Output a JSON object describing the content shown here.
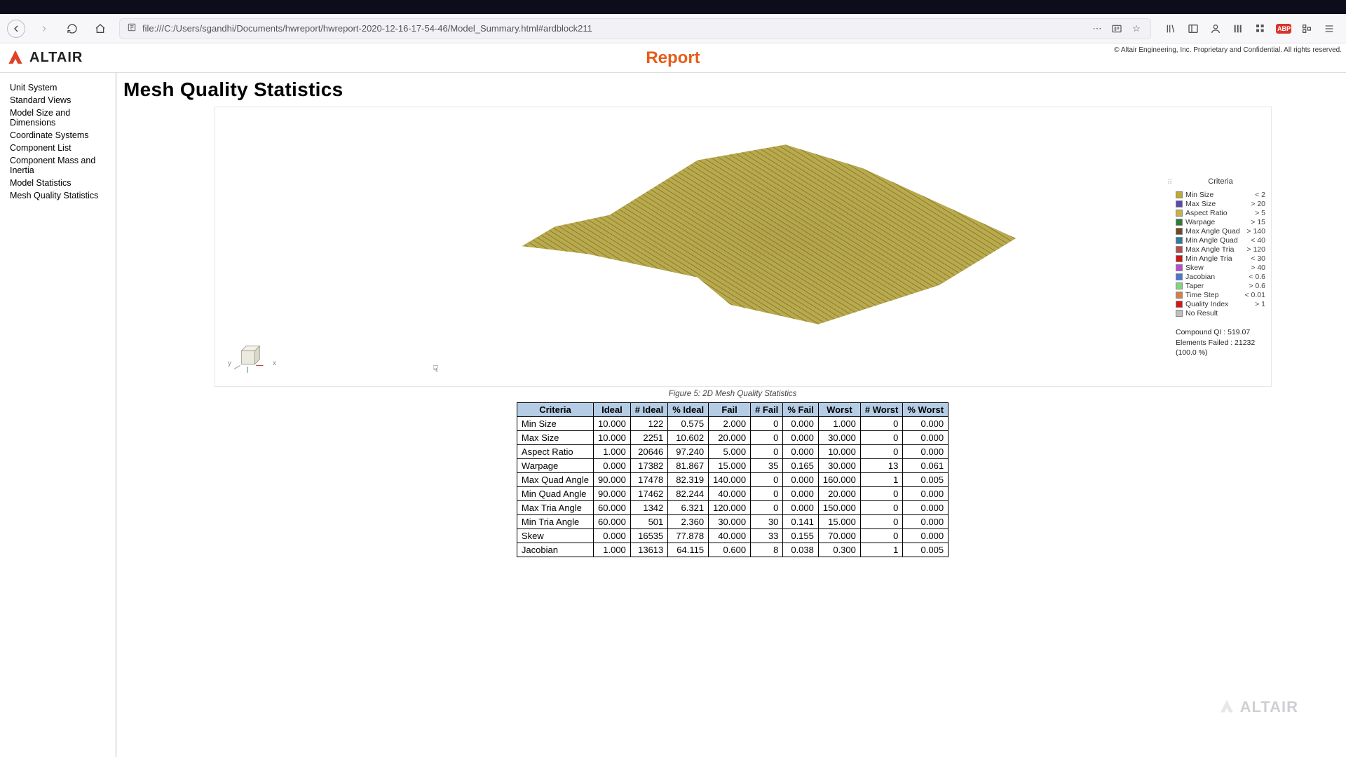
{
  "browser": {
    "url": "file:///C:/Users/sgandhi/Documents/hwreport/hwreport-2020-12-16-17-54-46/Model_Summary.html#ardblock211",
    "abp": "ABP"
  },
  "header": {
    "brand": "ALTAIR",
    "title": "Report",
    "copyright": "© Altair Engineering, Inc. Proprietary and Confidential. All rights reserved."
  },
  "sidebar": {
    "items": [
      "Unit System",
      "Standard Views",
      "Model Size and Dimensions",
      "Coordinate Systems",
      "Component List",
      "Component Mass and Inertia",
      "Model Statistics",
      "Mesh Quality Statistics"
    ]
  },
  "page": {
    "heading": "Mesh Quality Statistics",
    "caption": "Figure 5: 2D Mesh Quality Statistics",
    "triad": {
      "x": "x",
      "y": "y"
    }
  },
  "legend": {
    "title": "Criteria",
    "items": [
      {
        "name": "Min Size",
        "thr": "< 2",
        "color": "#c0a93a"
      },
      {
        "name": "Max Size",
        "thr": "> 20",
        "color": "#5b4ba8"
      },
      {
        "name": "Aspect Ratio",
        "thr": "> 5",
        "color": "#c5b34a"
      },
      {
        "name": "Warpage",
        "thr": "> 15",
        "color": "#2e7d32"
      },
      {
        "name": "Max Angle Quad",
        "thr": "> 140",
        "color": "#6e4a2a"
      },
      {
        "name": "Min Angle Quad",
        "thr": "< 40",
        "color": "#2e7d9a"
      },
      {
        "name": "Max Angle Tria",
        "thr": "> 120",
        "color": "#b84b4b"
      },
      {
        "name": "Min Angle Tria",
        "thr": "< 30",
        "color": "#cc1717"
      },
      {
        "name": "Skew",
        "thr": "> 40",
        "color": "#b84bd4"
      },
      {
        "name": "Jacobian",
        "thr": "< 0.6",
        "color": "#4b74d4"
      },
      {
        "name": "Taper",
        "thr": "> 0.6",
        "color": "#7fd47f"
      },
      {
        "name": "Time Step",
        "thr": "< 0.01",
        "color": "#d47f4b"
      },
      {
        "name": "Quality Index",
        "thr": "> 1",
        "color": "#d41717"
      },
      {
        "name": "No Result",
        "thr": "",
        "color": "#bfbfbf"
      }
    ],
    "footer1": "Compound QI : 519.07",
    "footer2": "Elements Failed : 21232 (100.0 %)"
  },
  "table": {
    "headers": [
      "Criteria",
      "Ideal",
      "# Ideal",
      "% Ideal",
      "Fail",
      "# Fail",
      "% Fail",
      "Worst",
      "# Worst",
      "% Worst"
    ],
    "rows": [
      [
        "Min Size",
        "10.000",
        "122",
        "0.575",
        "2.000",
        "0",
        "0.000",
        "1.000",
        "0",
        "0.000"
      ],
      [
        "Max Size",
        "10.000",
        "2251",
        "10.602",
        "20.000",
        "0",
        "0.000",
        "30.000",
        "0",
        "0.000"
      ],
      [
        "Aspect Ratio",
        "1.000",
        "20646",
        "97.240",
        "5.000",
        "0",
        "0.000",
        "10.000",
        "0",
        "0.000"
      ],
      [
        "Warpage",
        "0.000",
        "17382",
        "81.867",
        "15.000",
        "35",
        "0.165",
        "30.000",
        "13",
        "0.061"
      ],
      [
        "Max Quad Angle",
        "90.000",
        "17478",
        "82.319",
        "140.000",
        "0",
        "0.000",
        "160.000",
        "1",
        "0.005"
      ],
      [
        "Min Quad Angle",
        "90.000",
        "17462",
        "82.244",
        "40.000",
        "0",
        "0.000",
        "20.000",
        "0",
        "0.000"
      ],
      [
        "Max Tria Angle",
        "60.000",
        "1342",
        "6.321",
        "120.000",
        "0",
        "0.000",
        "150.000",
        "0",
        "0.000"
      ],
      [
        "Min Tria Angle",
        "60.000",
        "501",
        "2.360",
        "30.000",
        "30",
        "0.141",
        "15.000",
        "0",
        "0.000"
      ],
      [
        "Skew",
        "0.000",
        "16535",
        "77.878",
        "40.000",
        "33",
        "0.155",
        "70.000",
        "0",
        "0.000"
      ],
      [
        "Jacobian",
        "1.000",
        "13613",
        "64.115",
        "0.600",
        "8",
        "0.038",
        "0.300",
        "1",
        "0.005"
      ]
    ]
  }
}
